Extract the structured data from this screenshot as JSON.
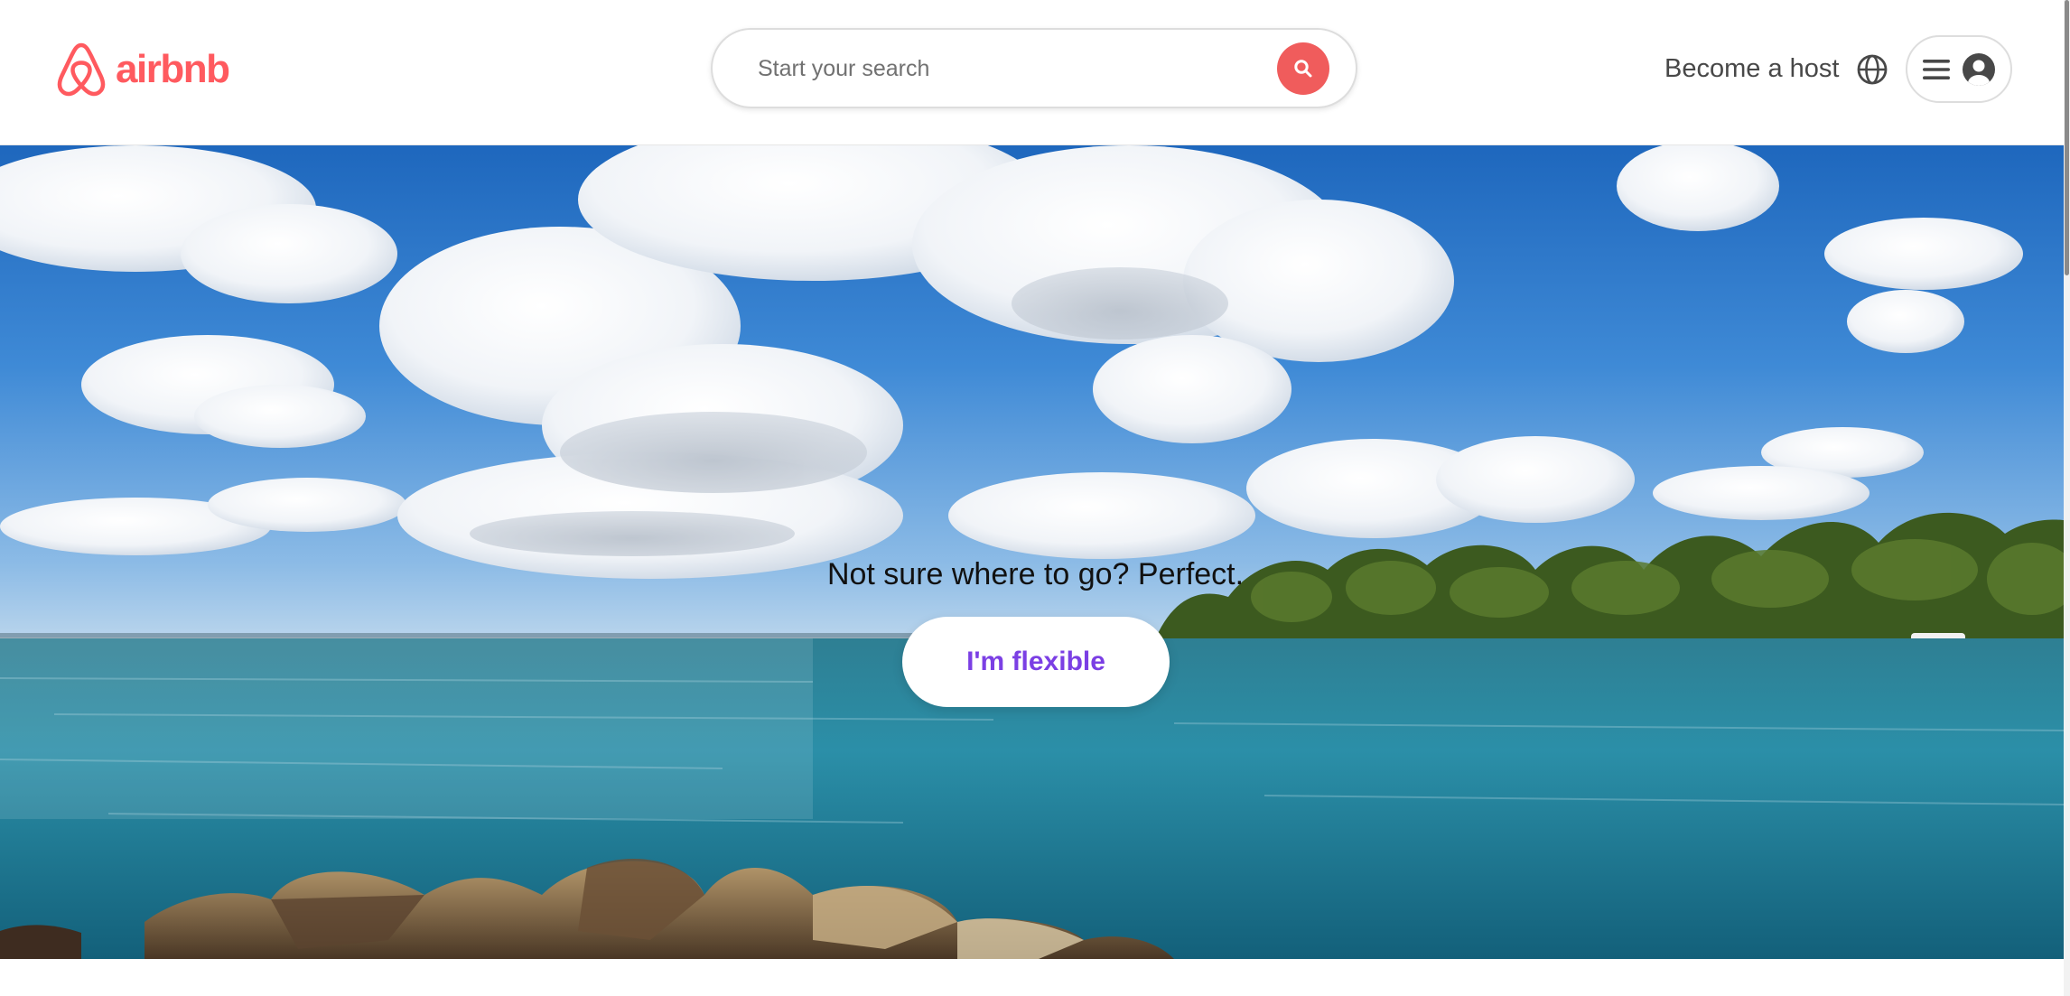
{
  "header": {
    "logo_text": "airbnb",
    "search": {
      "placeholder": "Start your search"
    },
    "become_host_label": "Become a host"
  },
  "hero": {
    "tagline": "Not sure where to go? Perfect.",
    "cta_label": "I'm flexible"
  },
  "icons": {
    "logo": "airbnb-belo-icon",
    "search": "search-icon",
    "language": "globe-icon",
    "menu": "hamburger-menu-icon",
    "account": "user-circle-icon"
  },
  "colors": {
    "brand": "#ff5a5f",
    "search_button": "#f05c5c",
    "cta_text": "#7b3fe4",
    "text_secondary": "#484848"
  }
}
